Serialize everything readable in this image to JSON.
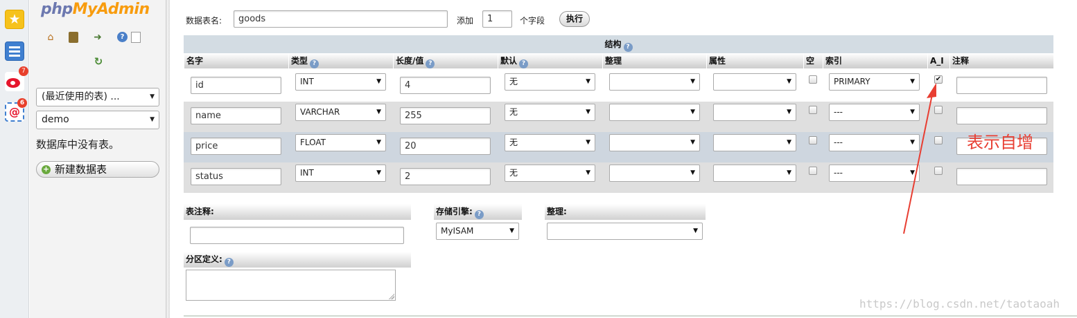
{
  "browser_sidebar": {
    "weibo_badge": "7",
    "mail_badge": "6"
  },
  "sidebar": {
    "logo_php": "php",
    "logo_myadmin": "MyAdmin",
    "recent_tables": "(最近使用的表) ...",
    "database": "demo",
    "no_tables": "数据库中没有表。",
    "new_db": "新建数据表"
  },
  "form": {
    "table_name_label": "数据表名:",
    "table_name": "goods",
    "add_label": "添加",
    "add_count": "1",
    "fields_label": "个字段",
    "go": "执行"
  },
  "structure": {
    "title": "结构",
    "columns": [
      "名字",
      "类型",
      "长度/值",
      "默认",
      "整理",
      "属性",
      "空",
      "索引",
      "A_I",
      "注释"
    ],
    "rows": [
      {
        "name": "id",
        "type": "INT",
        "length": "4",
        "default": "无",
        "index": "PRIMARY",
        "ai": true
      },
      {
        "name": "name",
        "type": "VARCHAR",
        "length": "255",
        "default": "无",
        "index": "---",
        "ai": false
      },
      {
        "name": "price",
        "type": "FLOAT",
        "length": "20",
        "default": "无",
        "index": "---",
        "ai": false
      },
      {
        "name": "status",
        "type": "INT",
        "length": "2",
        "default": "无",
        "index": "---",
        "ai": false
      }
    ]
  },
  "options": {
    "table_comment_label": "表注释:",
    "engine_label": "存储引擎:",
    "engine": "MyISAM",
    "collation_label": "整理:",
    "partition_label": "分区定义:"
  },
  "annotation": "表示自增",
  "watermark": "https://blog.csdn.net/taotaoah",
  "colors": {
    "annotation": "#e83e32",
    "logo_orange": "#f89c0e",
    "logo_blue": "#6c78af"
  }
}
